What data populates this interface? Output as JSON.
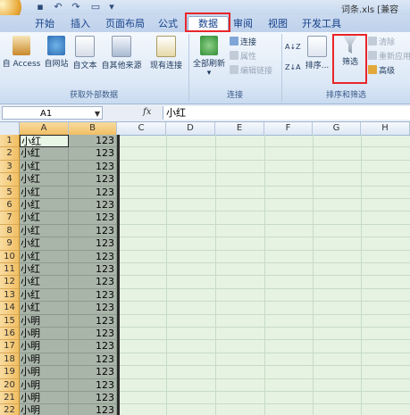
{
  "title_bar": {
    "filename": "词条.xls  [兼容"
  },
  "tabs": [
    {
      "label": "开始"
    },
    {
      "label": "插入"
    },
    {
      "label": "页面布局"
    },
    {
      "label": "公式"
    },
    {
      "label": "数据",
      "active": true
    },
    {
      "label": "审阅"
    },
    {
      "label": "视图"
    },
    {
      "label": "开发工具"
    }
  ],
  "ribbon": {
    "get_external": {
      "label": "获取外部数据",
      "buttons": [
        "自 Access",
        "自网站",
        "自文本",
        "自其他来源",
        "现有连接"
      ]
    },
    "connections": {
      "label": "连接",
      "refresh_all": "全部刷新",
      "connections": "连接",
      "properties": "属性",
      "edit_links": "编辑链接"
    },
    "sort_filter": {
      "label": "排序和筛选",
      "sort_az": "A↓Z",
      "sort_za": "Z↓A",
      "sort": "排序...",
      "filter": "筛选",
      "clear": "清除",
      "reapply": "重新应用",
      "advanced": "高级"
    }
  },
  "formula_bar": {
    "name_box": "A1",
    "fx": "fx",
    "value": "小红"
  },
  "columns": [
    "A",
    "B",
    "C",
    "D",
    "E",
    "F",
    "G",
    "H"
  ],
  "rows": [
    {
      "n": "1",
      "a": "小红",
      "b": "123"
    },
    {
      "n": "2",
      "a": "小红",
      "b": "123"
    },
    {
      "n": "3",
      "a": "小红",
      "b": "123"
    },
    {
      "n": "4",
      "a": "小红",
      "b": "123"
    },
    {
      "n": "5",
      "a": "小红",
      "b": "123"
    },
    {
      "n": "6",
      "a": "小红",
      "b": "123"
    },
    {
      "n": "7",
      "a": "小红",
      "b": "123"
    },
    {
      "n": "8",
      "a": "小红",
      "b": "123"
    },
    {
      "n": "9",
      "a": "小红",
      "b": "123"
    },
    {
      "n": "10",
      "a": "小红",
      "b": "123"
    },
    {
      "n": "11",
      "a": "小红",
      "b": "123"
    },
    {
      "n": "12",
      "a": "小红",
      "b": "123"
    },
    {
      "n": "13",
      "a": "小红",
      "b": "123"
    },
    {
      "n": "14",
      "a": "小红",
      "b": "123"
    },
    {
      "n": "15",
      "a": "小明",
      "b": "123"
    },
    {
      "n": "16",
      "a": "小明",
      "b": "123"
    },
    {
      "n": "17",
      "a": "小明",
      "b": "123"
    },
    {
      "n": "18",
      "a": "小明",
      "b": "123"
    },
    {
      "n": "19",
      "a": "小明",
      "b": "123"
    },
    {
      "n": "20",
      "a": "小明",
      "b": "123"
    },
    {
      "n": "21",
      "a": "小明",
      "b": "123"
    },
    {
      "n": "22",
      "a": "小明",
      "b": "123"
    }
  ],
  "colors": {
    "highlight": "#e8262a",
    "selection": "#aab5aa",
    "sheet_bg": "#e6f3e3"
  }
}
